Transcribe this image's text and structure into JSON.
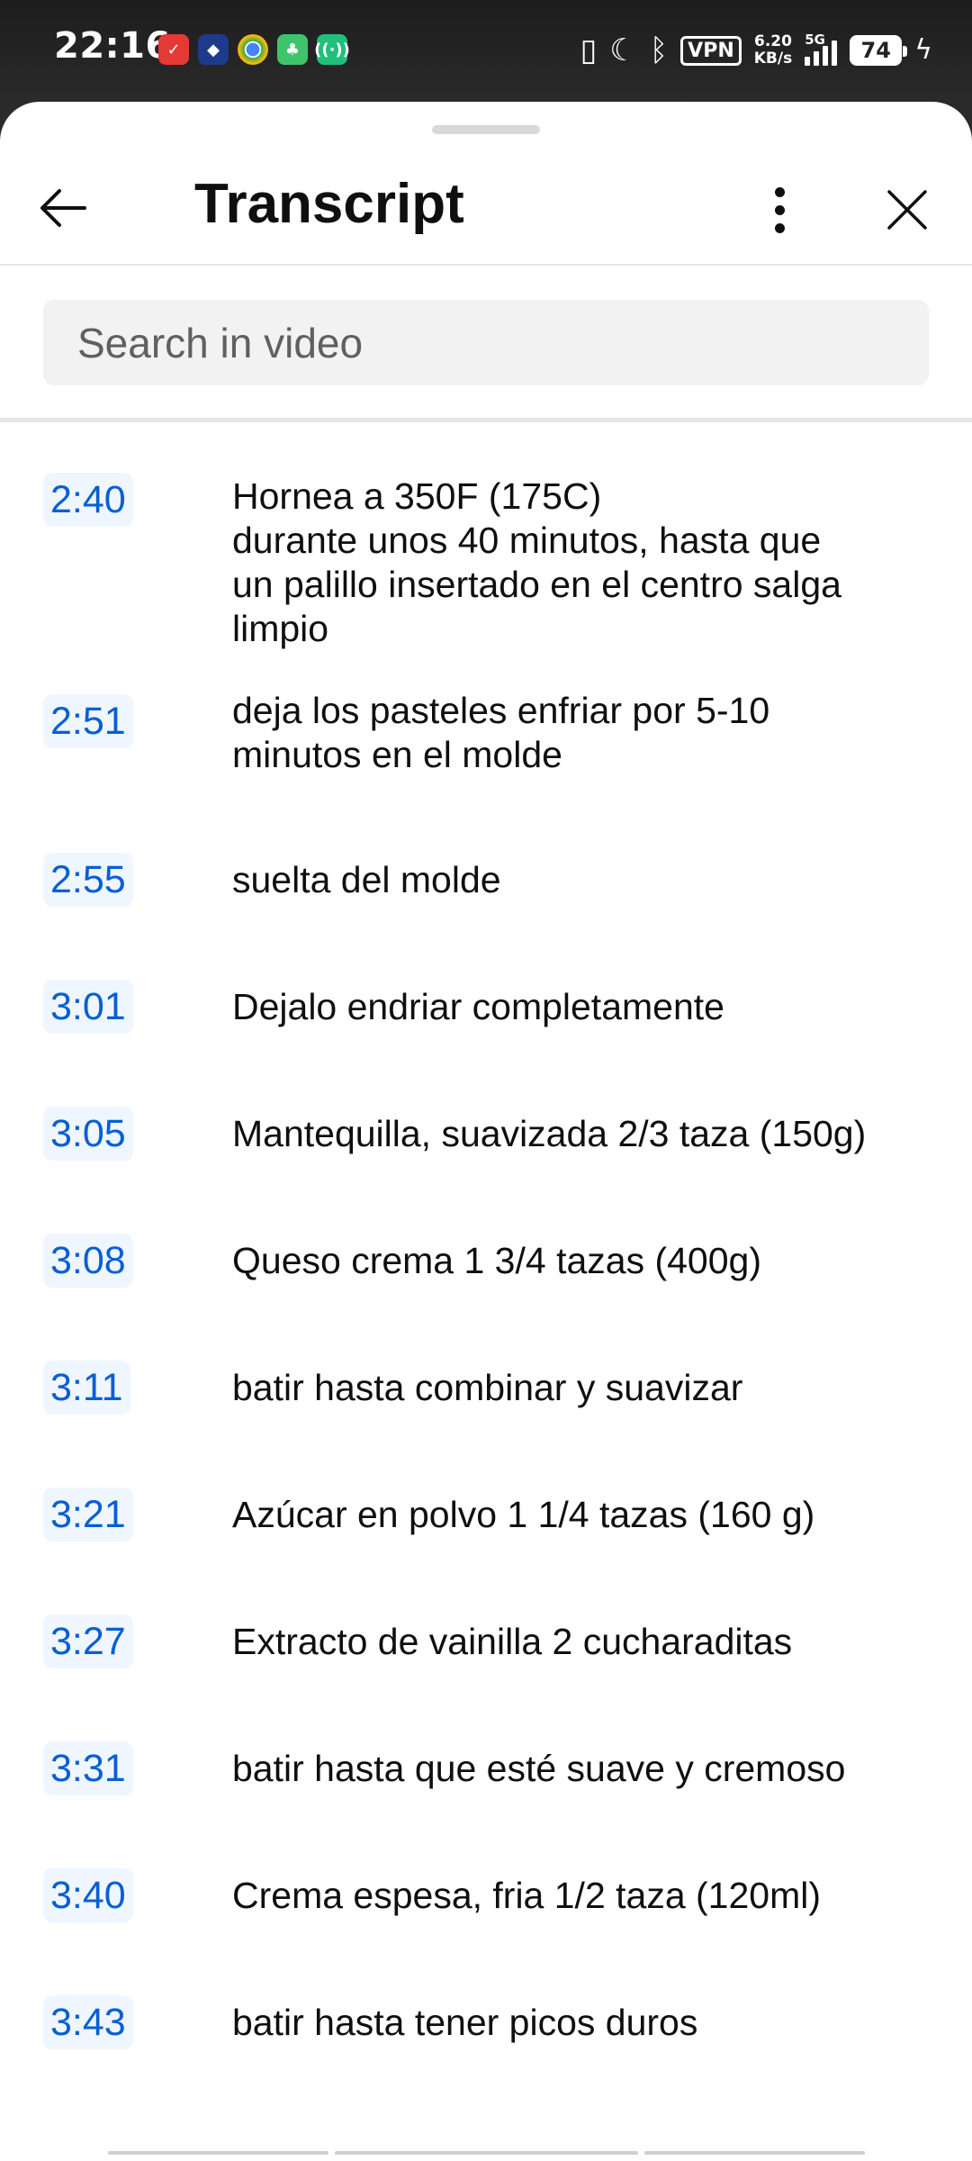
{
  "status_bar": {
    "time": "22:16",
    "vpn": "VPN",
    "speed_value": "6.20",
    "speed_unit": "KB/s",
    "network": "5G",
    "battery": "74"
  },
  "header": {
    "title": "Transcript"
  },
  "search": {
    "placeholder": "Search in video"
  },
  "segments": [
    {
      "time": "2:40",
      "text": "Hornea a 350F (175C)\ndurante unos 40 minutos, hasta que\nun palillo insertado en el centro salga\nlimpio"
    },
    {
      "time": "2:51",
      "text": "deja los pasteles enfriar por 5-10\nminutos en el molde"
    },
    {
      "time": "2:55",
      "text": "suelta del molde"
    },
    {
      "time": "3:01",
      "text": "Dejalo endriar completamente"
    },
    {
      "time": "3:05",
      "text": "Mantequilla, suavizada 2/3 taza (150g)"
    },
    {
      "time": "3:08",
      "text": "Queso crema 1 3/4 tazas (400g)"
    },
    {
      "time": "3:11",
      "text": "batir hasta combinar y suavizar"
    },
    {
      "time": "3:21",
      "text": "Azúcar en polvo 1 1/4 tazas (160 g)"
    },
    {
      "time": "3:27",
      "text": "Extracto de vainilla 2 cucharaditas"
    },
    {
      "time": "3:31",
      "text": "batir hasta que esté suave y cremoso"
    },
    {
      "time": "3:40",
      "text": "Crema espesa, fria 1/2 taza (120ml)"
    },
    {
      "time": "3:43",
      "text": "batir hasta tener picos duros"
    }
  ],
  "colors": {
    "accent": "#065fd4",
    "timestamp_bg": "#eff6ff",
    "text": "#0f0f0f",
    "placeholder": "#606060",
    "search_bg": "#f2f2f2"
  }
}
